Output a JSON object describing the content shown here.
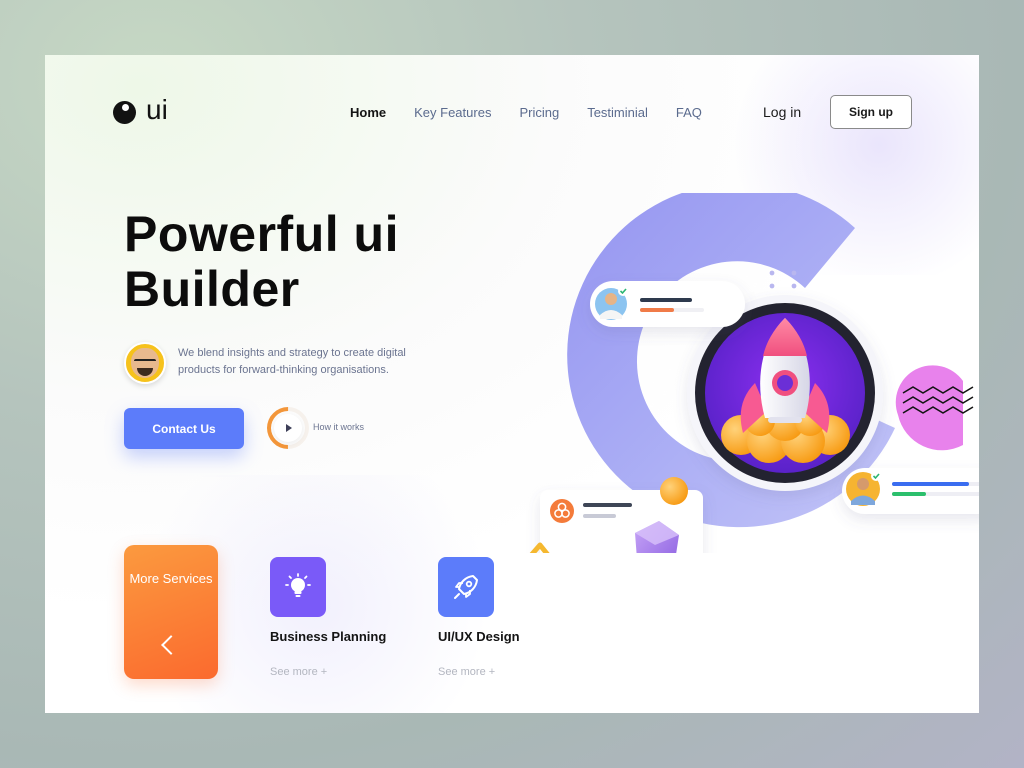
{
  "header": {
    "logo_text": "ui",
    "nav": [
      "Home",
      "Key Features",
      "Pricing",
      "Testiminial",
      "FAQ"
    ],
    "active_nav": "Home",
    "login_label": "Log in",
    "signup_label": "Sign up"
  },
  "hero": {
    "title": "Powerful ui Builder",
    "subtitle": "We blend insights and strategy to create digital products for forward-thinking organisations.",
    "contact_label": "Contact Us",
    "how_label": "How it works"
  },
  "services": {
    "more_label": "More Services",
    "items": [
      {
        "title": "Business Planning",
        "more": "See more +",
        "icon": "lightbulb-icon",
        "color": "#7a5af8"
      },
      {
        "title": "UI/UX Design",
        "more": "See more +",
        "icon": "rocket-icon",
        "color": "#5c7cfa"
      }
    ]
  },
  "colors": {
    "accent_blue": "#5c7cfa",
    "accent_purple": "#7a5af8",
    "accent_orange": "#fb7a33"
  }
}
